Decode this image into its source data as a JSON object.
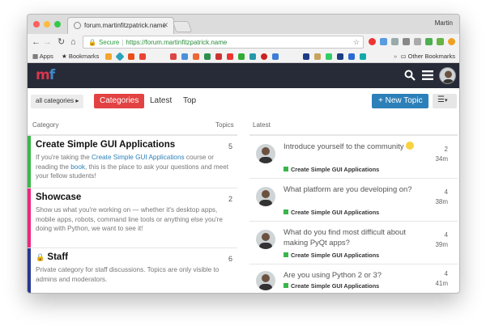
{
  "browser": {
    "tab_title": "forum.martinfitzpatrick.name",
    "user_name": "Martin",
    "secure_label": "Secure",
    "url": "https://forum.martinfitzpatrick.name",
    "bookmarks": [
      "Apps",
      "Bookmarks"
    ],
    "other_bookmarks": "Other Bookmarks"
  },
  "site": {
    "logo_m": "m",
    "logo_f": "f"
  },
  "nav": {
    "all_categories": "all categories",
    "categories": "Categories",
    "latest": "Latest",
    "top": "Top",
    "new_topic": "New Topic"
  },
  "columns": {
    "category": "Category",
    "topics": "Topics",
    "latest": "Latest"
  },
  "categories": [
    {
      "title": "Create Simple GUI Applications",
      "count": "5",
      "color": "#3ab54a",
      "desc_pre": "If you're taking the ",
      "desc_link": "Create Simple GUI Applications",
      "desc_mid": " course or reading the ",
      "desc_link2": "book",
      "desc_post": ", this is the place to ask your questions and meet your fellow students!"
    },
    {
      "title": "Showcase",
      "count": "2",
      "color": "#e9297f",
      "desc": "Show us what you're working on — whether it's desktop apps, mobile apps, robots, command line tools or anything else you're doing with Python, we want to see it!"
    },
    {
      "title": "Staff",
      "count": "6",
      "color": "#283890",
      "desc": "Private category for staff discussions. Topics are only visible to admins and moderators."
    }
  ],
  "latest": [
    {
      "title": "Introduce yourself to the community",
      "category": "Create Simple GUI Applications",
      "count": "2",
      "time": "34m"
    },
    {
      "title": "What platform are you developing on?",
      "category": "Create Simple GUI Applications",
      "count": "4",
      "time": "38m"
    },
    {
      "title": "What do you find most difficult about making PyQt apps?",
      "category": "Create Simple GUI Applications",
      "count": "4",
      "time": "39m"
    },
    {
      "title": "Are you using Python 2 or 3?",
      "category": "Create Simple GUI Applications",
      "count": "4",
      "time": "41m"
    }
  ]
}
